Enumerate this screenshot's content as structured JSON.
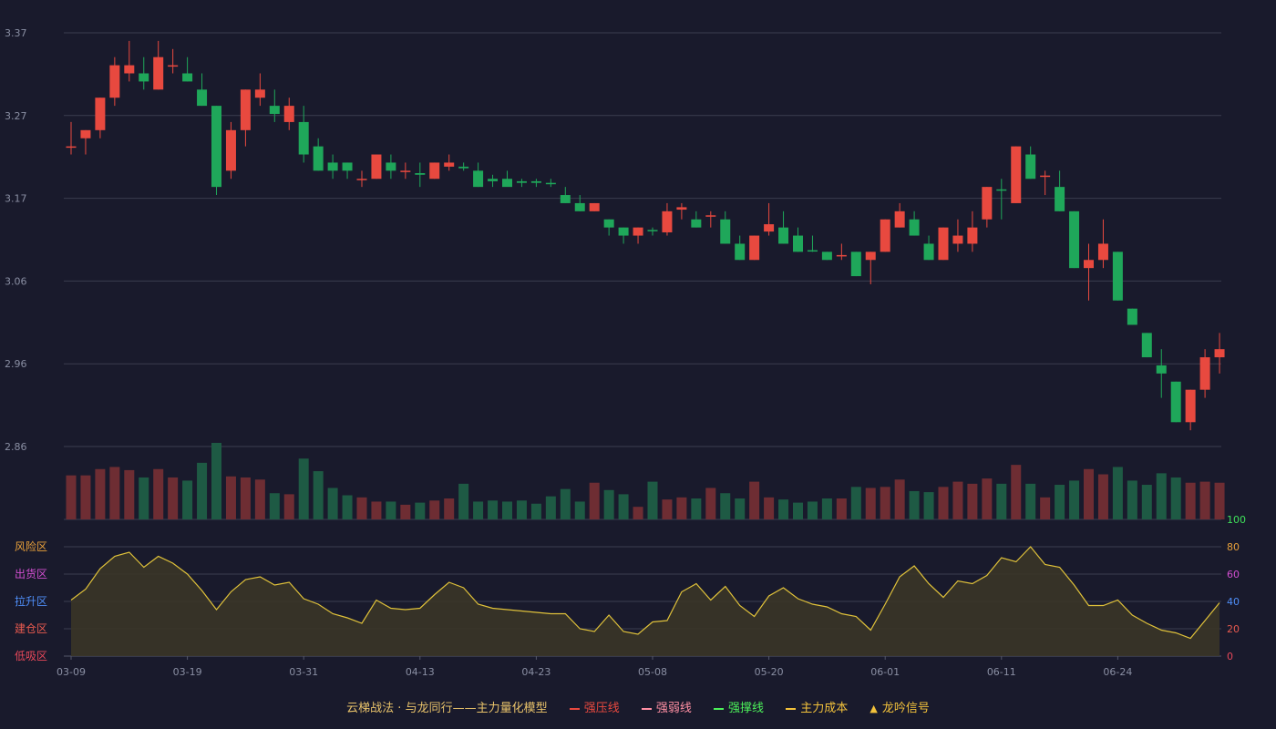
{
  "chart_data": {
    "type": "candlestick",
    "price_axis": {
      "ticks": [
        "3.37",
        "3.27",
        "3.17",
        "3.06",
        "2.96",
        "2.86"
      ],
      "ylim": [
        2.86,
        3.37
      ]
    },
    "osc_axis": {
      "ticks": [
        "100",
        "80",
        "60",
        "40",
        "20",
        "0"
      ],
      "ylim": [
        0,
        100
      ]
    },
    "zones": [
      {
        "label": "风险区",
        "color": "#e9a13b"
      },
      {
        "label": "出货区",
        "color": "#d14fd0"
      },
      {
        "label": "拉升区",
        "color": "#4f8ef7"
      },
      {
        "label": "建仓区",
        "color": "#e85a4f"
      },
      {
        "label": "低吸区",
        "color": "#e8485a"
      }
    ],
    "x_tick_labels": [
      {
        "label": "03-09",
        "index": 0
      },
      {
        "label": "03-19",
        "index": 8
      },
      {
        "label": "03-31",
        "index": 16
      },
      {
        "label": "04-13",
        "index": 24
      },
      {
        "label": "04-23",
        "index": 32
      },
      {
        "label": "05-08",
        "index": 40
      },
      {
        "label": "05-20",
        "index": 48
      },
      {
        "label": "06-01",
        "index": 56
      },
      {
        "label": "06-11",
        "index": 64
      },
      {
        "label": "06-24",
        "index": 72
      }
    ],
    "ohlc": [
      [
        3.23,
        3.26,
        3.22,
        3.23
      ],
      [
        3.24,
        3.25,
        3.22,
        3.25
      ],
      [
        3.25,
        3.29,
        3.24,
        3.29
      ],
      [
        3.29,
        3.34,
        3.28,
        3.33
      ],
      [
        3.32,
        3.36,
        3.31,
        3.33
      ],
      [
        3.32,
        3.34,
        3.3,
        3.31
      ],
      [
        3.3,
        3.36,
        3.3,
        3.34
      ],
      [
        3.33,
        3.35,
        3.32,
        3.33
      ],
      [
        3.32,
        3.34,
        3.31,
        3.31
      ],
      [
        3.3,
        3.32,
        3.28,
        3.28
      ],
      [
        3.28,
        3.28,
        3.17,
        3.18
      ],
      [
        3.2,
        3.26,
        3.19,
        3.25
      ],
      [
        3.25,
        3.3,
        3.23,
        3.3
      ],
      [
        3.29,
        3.32,
        3.28,
        3.3
      ],
      [
        3.28,
        3.3,
        3.26,
        3.27
      ],
      [
        3.26,
        3.29,
        3.25,
        3.28
      ],
      [
        3.26,
        3.28,
        3.21,
        3.22
      ],
      [
        3.23,
        3.24,
        3.2,
        3.2
      ],
      [
        3.21,
        3.22,
        3.19,
        3.2
      ],
      [
        3.21,
        3.21,
        3.19,
        3.2
      ],
      [
        3.19,
        3.2,
        3.18,
        3.19
      ],
      [
        3.19,
        3.22,
        3.19,
        3.22
      ],
      [
        3.21,
        3.22,
        3.19,
        3.2
      ],
      [
        3.2,
        3.21,
        3.19,
        3.2
      ],
      [
        3.197,
        3.21,
        3.18,
        3.195
      ],
      [
        3.19,
        3.21,
        3.19,
        3.21
      ],
      [
        3.205,
        3.22,
        3.2,
        3.21
      ],
      [
        3.205,
        3.21,
        3.2,
        3.203
      ],
      [
        3.2,
        3.21,
        3.18,
        3.18
      ],
      [
        3.19,
        3.195,
        3.18,
        3.187
      ],
      [
        3.19,
        3.2,
        3.185,
        3.18
      ],
      [
        3.187,
        3.19,
        3.18,
        3.185
      ],
      [
        3.187,
        3.19,
        3.18,
        3.185
      ],
      [
        3.185,
        3.19,
        3.18,
        3.184
      ],
      [
        3.17,
        3.18,
        3.16,
        3.16
      ],
      [
        3.16,
        3.17,
        3.15,
        3.15
      ],
      [
        3.15,
        3.16,
        3.15,
        3.16
      ],
      [
        3.14,
        3.14,
        3.12,
        3.13
      ],
      [
        3.13,
        3.13,
        3.11,
        3.12
      ],
      [
        3.12,
        3.13,
        3.11,
        3.13
      ],
      [
        3.127,
        3.13,
        3.12,
        3.126
      ],
      [
        3.124,
        3.16,
        3.12,
        3.15
      ],
      [
        3.152,
        3.16,
        3.14,
        3.155
      ],
      [
        3.14,
        3.15,
        3.13,
        3.13
      ],
      [
        3.145,
        3.15,
        3.13,
        3.145
      ],
      [
        3.14,
        3.15,
        3.11,
        3.11
      ],
      [
        3.11,
        3.12,
        3.09,
        3.09
      ],
      [
        3.09,
        3.12,
        3.09,
        3.12
      ],
      [
        3.125,
        3.16,
        3.12,
        3.134
      ],
      [
        3.13,
        3.15,
        3.11,
        3.11
      ],
      [
        3.12,
        3.13,
        3.1,
        3.1
      ],
      [
        3.102,
        3.12,
        3.1,
        3.101
      ],
      [
        3.1,
        3.1,
        3.09,
        3.09
      ],
      [
        3.095,
        3.11,
        3.09,
        3.096
      ],
      [
        3.1,
        3.1,
        3.07,
        3.07
      ],
      [
        3.09,
        3.1,
        3.06,
        3.1
      ],
      [
        3.1,
        3.14,
        3.1,
        3.14
      ],
      [
        3.13,
        3.16,
        3.13,
        3.15
      ],
      [
        3.14,
        3.15,
        3.12,
        3.12
      ],
      [
        3.11,
        3.12,
        3.09,
        3.09
      ],
      [
        3.09,
        3.13,
        3.09,
        3.13
      ],
      [
        3.11,
        3.14,
        3.1,
        3.12
      ],
      [
        3.11,
        3.15,
        3.1,
        3.13
      ],
      [
        3.14,
        3.18,
        3.13,
        3.18
      ],
      [
        3.177,
        3.19,
        3.14,
        3.176
      ],
      [
        3.16,
        3.23,
        3.16,
        3.23
      ],
      [
        3.22,
        3.23,
        3.19,
        3.19
      ],
      [
        3.193,
        3.2,
        3.17,
        3.194
      ],
      [
        3.18,
        3.2,
        3.15,
        3.15
      ],
      [
        3.15,
        3.15,
        3.08,
        3.08
      ],
      [
        3.08,
        3.11,
        3.04,
        3.09
      ],
      [
        3.09,
        3.14,
        3.08,
        3.11
      ],
      [
        3.1,
        3.1,
        3.04,
        3.04
      ],
      [
        3.03,
        3.03,
        3.01,
        3.01
      ],
      [
        3.0,
        3.0,
        2.97,
        2.97
      ],
      [
        2.96,
        2.98,
        2.92,
        2.95
      ],
      [
        2.94,
        2.94,
        2.89,
        2.89
      ],
      [
        2.89,
        2.93,
        2.88,
        2.93
      ],
      [
        2.93,
        2.98,
        2.92,
        2.97
      ],
      [
        2.97,
        3.0,
        2.95,
        2.98
      ]
    ],
    "volume": [
      42,
      42,
      48,
      50,
      47,
      40,
      48,
      40,
      37,
      54,
      73,
      41,
      40,
      38,
      25,
      24,
      58,
      46,
      30,
      23,
      21,
      17,
      17,
      14,
      16,
      18,
      20,
      34,
      17,
      18,
      17,
      18,
      15,
      22,
      29,
      17,
      35,
      28,
      24,
      12,
      36,
      19,
      21,
      20,
      30,
      25,
      20,
      36,
      21,
      19,
      16,
      17,
      20,
      20,
      31,
      30,
      31,
      38,
      27,
      26,
      31,
      36,
      34,
      39,
      34,
      52,
      34,
      21,
      33,
      37,
      48,
      43,
      50,
      37,
      33,
      44,
      40,
      35,
      36,
      35
    ],
    "oscillator": [
      41,
      49,
      64,
      73,
      76,
      65,
      73,
      68,
      60,
      48,
      34,
      47,
      56,
      58,
      52,
      54,
      42,
      38,
      31,
      28,
      24,
      41,
      35,
      34,
      35,
      45,
      54,
      50,
      38,
      35,
      34,
      33,
      32,
      31,
      31,
      20,
      18,
      30,
      18,
      16,
      25,
      26,
      47,
      53,
      41,
      51,
      37,
      29,
      44,
      50,
      42,
      38,
      36,
      31,
      29,
      19,
      38,
      58,
      66,
      53,
      43,
      55,
      53,
      59,
      72,
      69,
      80,
      67,
      65,
      52,
      37,
      37,
      41,
      30,
      24,
      19,
      17,
      13,
      26,
      39
    ]
  },
  "legend": {
    "title": "云梯战法 · 与龙同行——主力量化模型",
    "items": [
      {
        "label": "强压线",
        "color": "#e8493f",
        "style": "solid"
      },
      {
        "label": "强弱线",
        "color": "#ff8fa3",
        "style": "dashed"
      },
      {
        "label": "强撑线",
        "color": "#4cf05a",
        "style": "solid"
      },
      {
        "label": "主力成本",
        "color": "#f3c23b",
        "style": "dashed"
      },
      {
        "label": "龙吟信号",
        "color": "#f3c23b",
        "style": "triangle"
      }
    ]
  },
  "colors": {
    "up": "#e8493f",
    "down": "#1fa75a",
    "vol_up": "#6e2d33",
    "vol_down": "#1e5a44",
    "line": "#e0c23a",
    "axis_text": "#8a8fa3",
    "grid": "#3b3d4f"
  }
}
